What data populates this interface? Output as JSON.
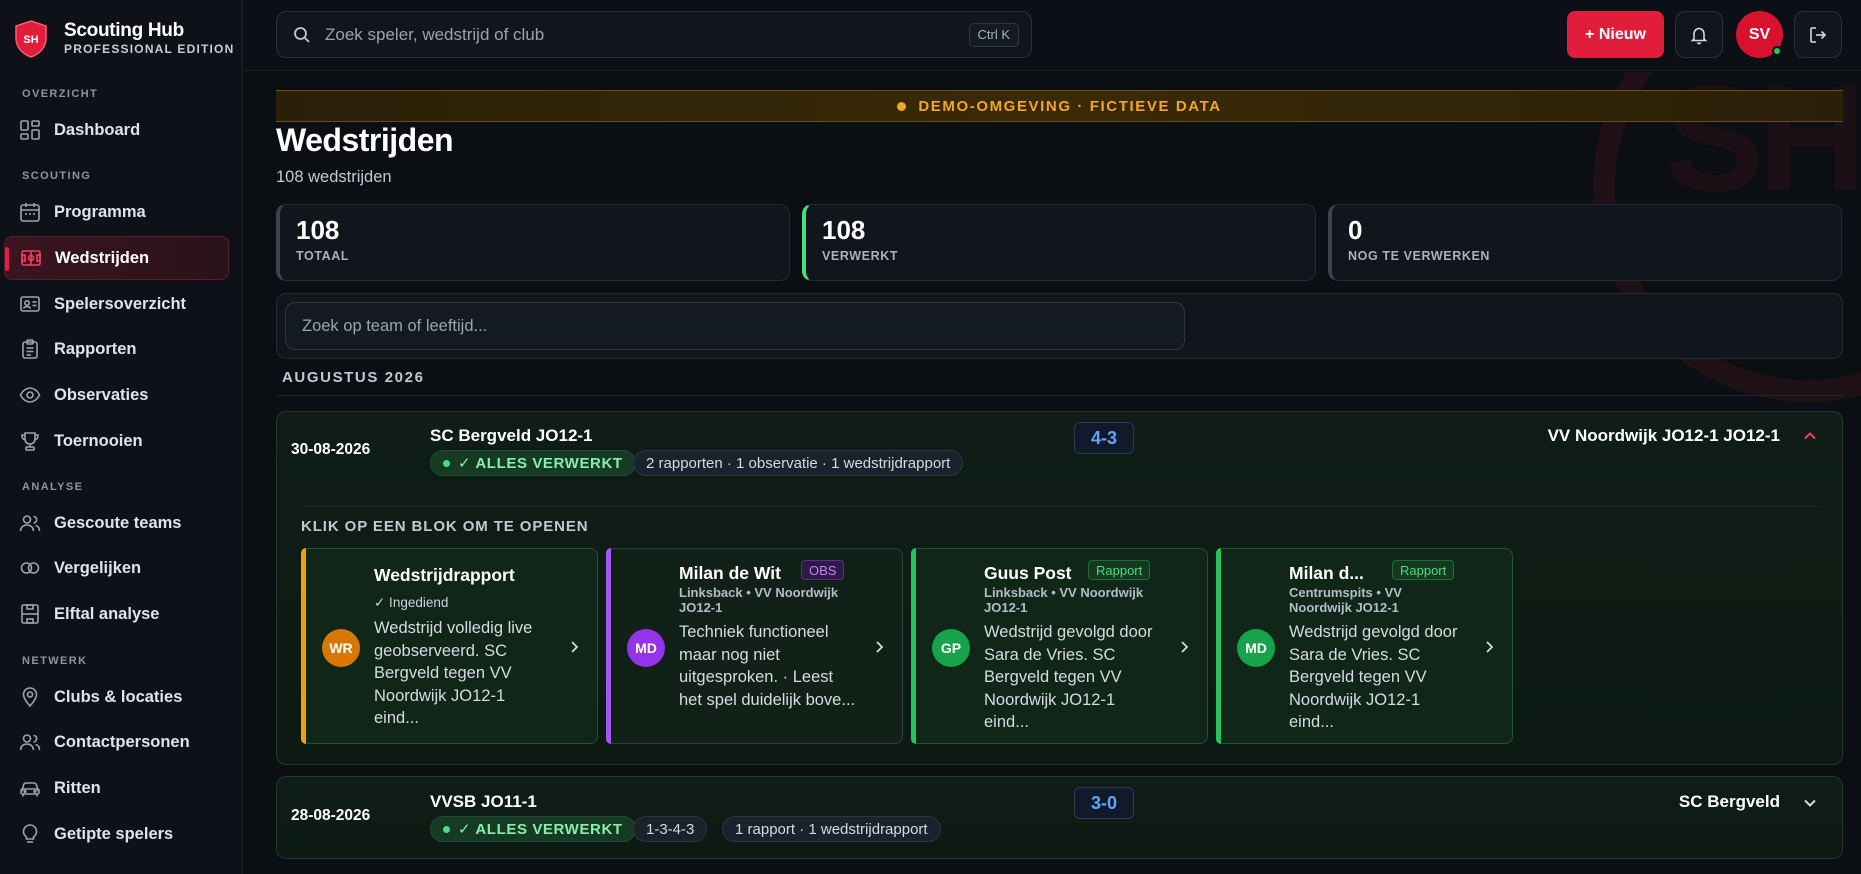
{
  "brand": {
    "title": "Scouting Hub",
    "subtitle": "PROFESSIONAL EDITION",
    "logo_text": "SH"
  },
  "sidebar": {
    "sections": [
      {
        "label": "OVERZICHT"
      },
      {
        "label": "SCOUTING"
      },
      {
        "label": "ANALYSE"
      },
      {
        "label": "NETWERK"
      }
    ],
    "items": [
      {
        "label": "Dashboard",
        "icon": "dashboard-icon"
      },
      {
        "label": "Programma",
        "icon": "calendar-icon"
      },
      {
        "label": "Wedstrijden",
        "icon": "pitch-icon",
        "active": true
      },
      {
        "label": "Spelersoverzicht",
        "icon": "id-card-icon"
      },
      {
        "label": "Rapporten",
        "icon": "clipboard-icon"
      },
      {
        "label": "Observaties",
        "icon": "eye-icon"
      },
      {
        "label": "Toernooien",
        "icon": "trophy-icon"
      },
      {
        "label": "Gescoute teams",
        "icon": "users-icon"
      },
      {
        "label": "Vergelijken",
        "icon": "compare-icon"
      },
      {
        "label": "Elftal analyse",
        "icon": "formation-icon"
      },
      {
        "label": "Clubs & locaties",
        "icon": "map-pin-icon"
      },
      {
        "label": "Contactpersonen",
        "icon": "contacts-icon"
      },
      {
        "label": "Ritten",
        "icon": "car-icon"
      },
      {
        "label": "Getipte spelers",
        "icon": "lightbulb-icon"
      }
    ]
  },
  "topbar": {
    "search_placeholder": "Zoek speler, wedstrijd of club",
    "search_shortcut": "Ctrl K",
    "new_button": "+ Nieuw",
    "user_initials": "SV"
  },
  "banner": {
    "text": "DEMO-OMGEVING · FICTIEVE DATA",
    "color": "#f5a524"
  },
  "page": {
    "title": "Wedstrijden",
    "subtitle": "108 wedstrijden"
  },
  "stats": [
    {
      "value": "108",
      "label": "TOTAAL"
    },
    {
      "value": "108",
      "label": "VERWERKT"
    },
    {
      "value": "0",
      "label": "NOG TE VERWERKEN"
    }
  ],
  "filter": {
    "placeholder": "Zoek op team of leeftijd..."
  },
  "month_label": "AUGUSTUS 2026",
  "matches": [
    {
      "date": "30-08-2026",
      "home": "SC Bergveld JO12-1",
      "score": "4-3",
      "away": "VV Noordwijk JO12-1 JO12-1",
      "status": "✓ ALLES VERWERKT",
      "summary": "2 rapporten · 1 observatie · 1 wedstrijdrapport",
      "open_hint": "KLIK OP EEN BLOK OM TE OPENEN",
      "blocks": [
        {
          "initials": "WR",
          "title": "Wedstrijdrapport",
          "meta": "✓ Ingediend",
          "text": "Wedstrijd volledig live geobserveerd. SC Bergveld tegen VV Noordwijk JO12-1 eind...",
          "color": "#f59e0b"
        },
        {
          "initials": "MD",
          "title": "Milan de Wit",
          "tag": "OBS",
          "meta": "Linksback • VV Noordwijk JO12-1",
          "text": "Techniek functioneel maar nog niet uitgesproken. · Leest het spel duidelijk bove...",
          "color": "#a855f7"
        },
        {
          "initials": "GP",
          "title": "Guus Post",
          "tag": "Rapport",
          "meta": "Linksback • VV Noordwijk JO12-1",
          "text": "Wedstrijd gevolgd door Sara de Vries. SC Bergveld tegen VV Noordwijk JO12-1 eind...",
          "color": "#22c55e"
        },
        {
          "initials": "MD",
          "title": "Milan d...",
          "tag": "Rapport",
          "meta": "Centrumspits • VV Noordwijk JO12-1",
          "text": "Wedstrijd gevolgd door Sara de Vries. SC Bergveld tegen VV Noordwijk JO12-1 eind...",
          "color": "#22c55e"
        }
      ]
    },
    {
      "date": "28-08-2026",
      "home": "VVSB JO11-1",
      "score": "3-0",
      "away": "SC Bergveld",
      "status": "✓ ALLES VERWERKT",
      "formation": "1-3-4-3",
      "summary": "1 rapport · 1 wedstrijdrapport"
    }
  ]
}
